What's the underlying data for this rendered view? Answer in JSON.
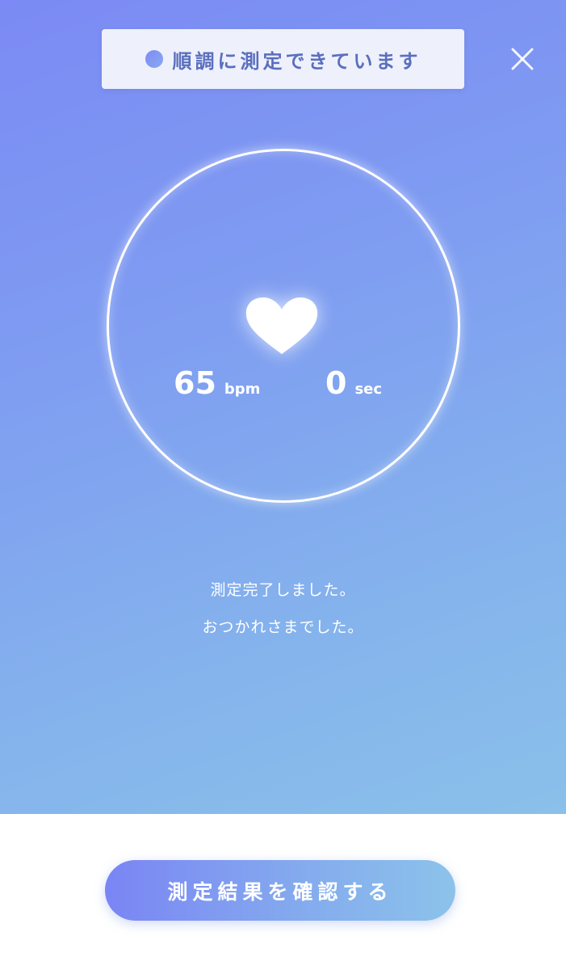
{
  "status": {
    "text": "順調に測定できています"
  },
  "close": {
    "icon": "close-icon"
  },
  "measurement": {
    "heart_icon": "heart-icon",
    "heart_rate_value": "65",
    "heart_rate_unit": "bpm",
    "elapsed_value": "0",
    "elapsed_unit": "sec"
  },
  "messages": {
    "line1": "測定完了しました。",
    "line2": "おつかれさまでした。"
  },
  "actions": {
    "confirm_label": "測定結果を確認する"
  },
  "colors": {
    "gradient_start": "#7b8af4",
    "gradient_end": "#8ac0ea",
    "banner_text": "#5b6fbf",
    "banner_bg": "#eef1fb"
  }
}
